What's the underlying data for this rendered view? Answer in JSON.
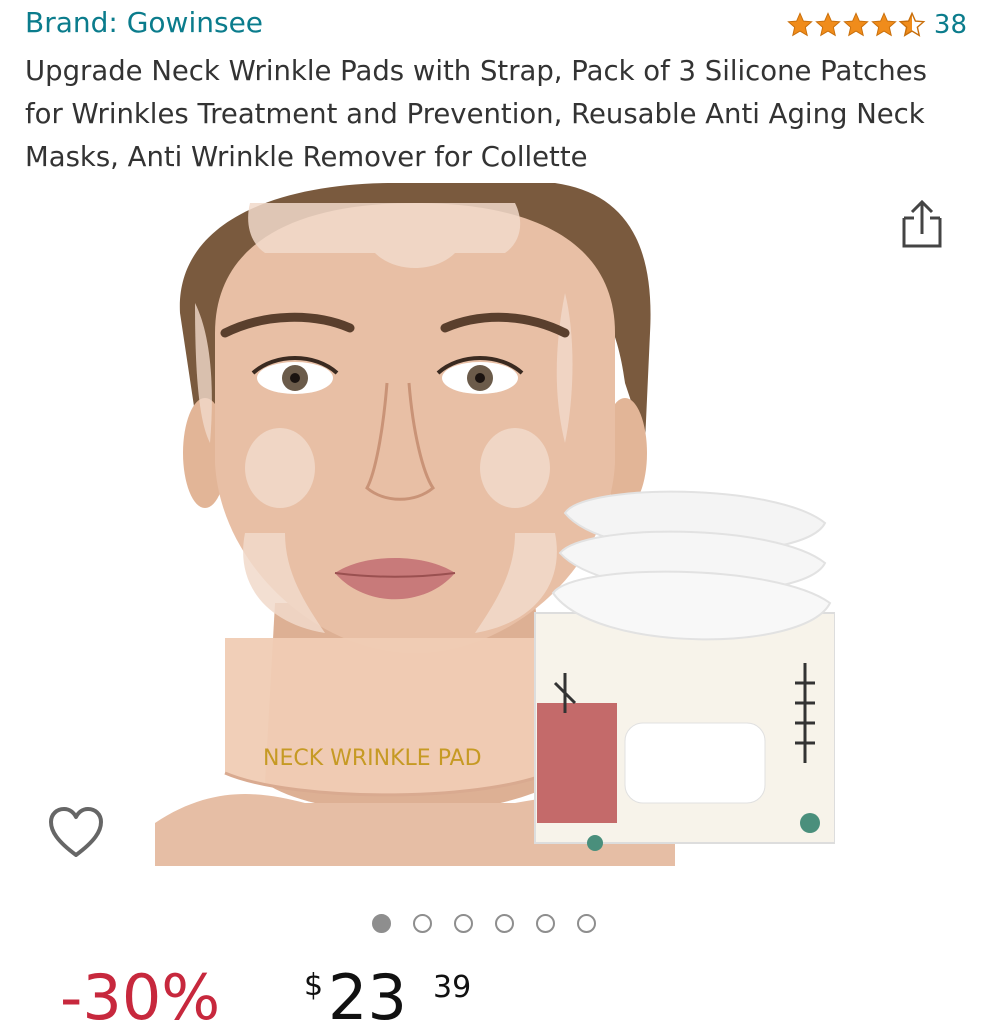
{
  "header": {
    "brand_label": "Brand: Gowinsee",
    "rating_stars": 4.5,
    "rating_count": "38"
  },
  "product": {
    "title": "Upgrade Neck Wrinkle Pads with Strap, Pack of 3 Silicone Patches for Wrinkles Treatment and Prevention, Reusable Anti Aging Neck Masks, Anti Wrinkle Remover for Collette",
    "image_text": "NECK WRINKLE PAD"
  },
  "carousel": {
    "total_images": 6,
    "active_index": 0
  },
  "price": {
    "discount": "-30%",
    "symbol": "$",
    "whole": "23",
    "fraction": "39"
  },
  "icons": {
    "share": "share-icon",
    "wishlist": "heart-icon",
    "star": "star-icon"
  },
  "colors": {
    "link": "#0b7c8c",
    "star": "#f08c1b",
    "discount": "#c7283d",
    "dot": "#8e8e8e"
  }
}
